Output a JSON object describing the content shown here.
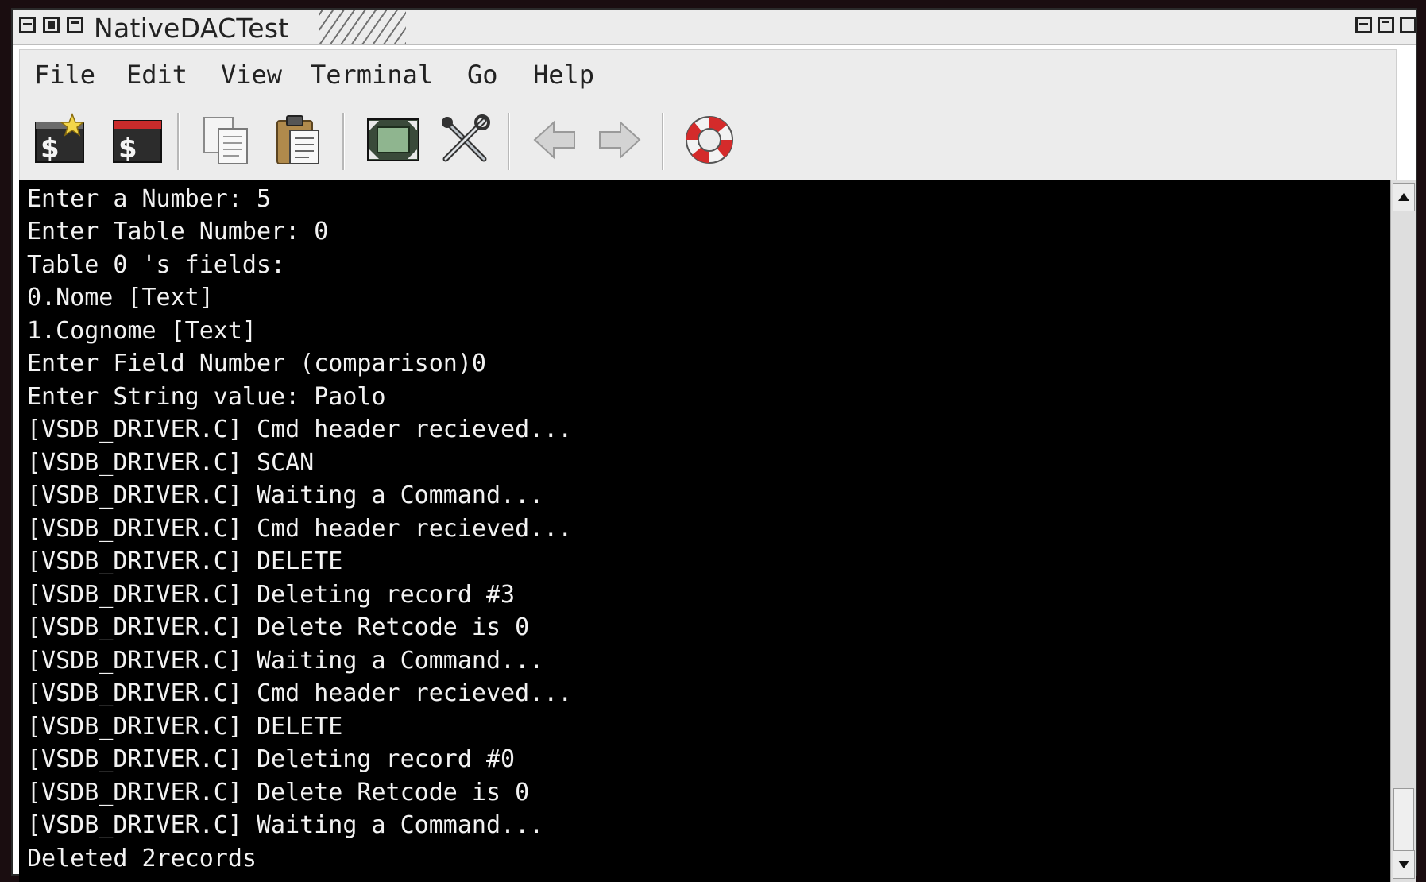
{
  "window": {
    "title": "NativeDACTest"
  },
  "menu": {
    "items": [
      {
        "label": "File"
      },
      {
        "label": "Edit"
      },
      {
        "label": "View"
      },
      {
        "label": "Terminal"
      },
      {
        "label": "Go"
      },
      {
        "label": "Help"
      }
    ]
  },
  "toolbar": {
    "buttons": [
      {
        "icon": "new-tab-icon"
      },
      {
        "icon": "new-window-icon"
      },
      {
        "icon": "copy-icon"
      },
      {
        "icon": "paste-icon"
      },
      {
        "icon": "fullscreen-icon"
      },
      {
        "icon": "preferences-icon"
      },
      {
        "icon": "back-arrow-icon"
      },
      {
        "icon": "forward-arrow-icon"
      },
      {
        "icon": "help-lifebuoy-icon"
      }
    ]
  },
  "terminal": {
    "lines": [
      "Enter a Number: 5",
      "Enter Table Number: 0",
      "Table 0 's fields:",
      "0.Nome [Text]",
      "1.Cognome [Text]",
      "Enter Field Number (comparison)0",
      "Enter String value: Paolo",
      "[VSDB_DRIVER.C] Cmd header recieved...",
      "[VSDB_DRIVER.C] SCAN",
      "[VSDB_DRIVER.C] Waiting a Command...",
      "[VSDB_DRIVER.C] Cmd header recieved...",
      "[VSDB_DRIVER.C] DELETE",
      "[VSDB_DRIVER.C] Deleting record #3",
      "[VSDB_DRIVER.C] Delete Retcode is 0",
      "[VSDB_DRIVER.C] Waiting a Command...",
      "[VSDB_DRIVER.C] Cmd header recieved...",
      "[VSDB_DRIVER.C] DELETE",
      "[VSDB_DRIVER.C] Deleting record #0",
      "[VSDB_DRIVER.C] Delete Retcode is 0",
      "[VSDB_DRIVER.C] Waiting a Command...",
      "Deleted 2records"
    ]
  },
  "colors": {
    "terminal_bg": "#000000",
    "terminal_fg": "#f2f2f2",
    "chrome_bg": "#ececec"
  }
}
